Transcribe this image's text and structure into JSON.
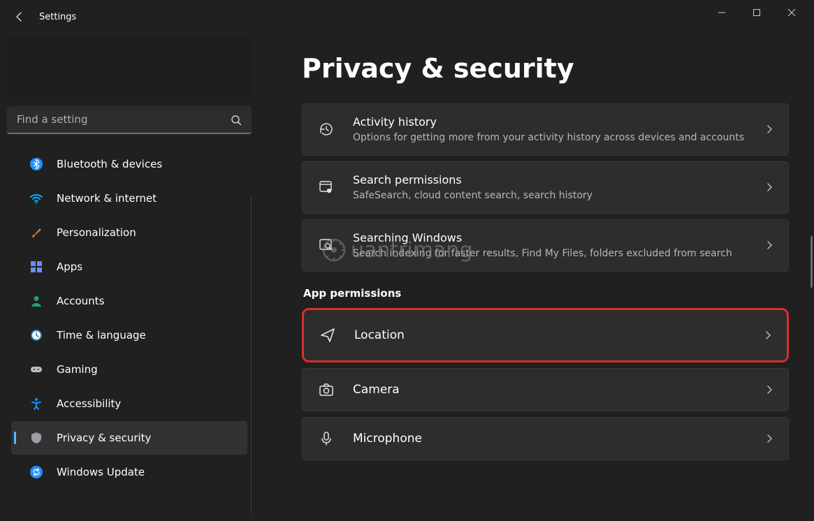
{
  "app": {
    "title": "Settings"
  },
  "search": {
    "placeholder": "Find a setting"
  },
  "sidebar": {
    "items": [
      {
        "label": "Bluetooth & devices",
        "icon": "bluetooth",
        "color": "#1e90ff"
      },
      {
        "label": "Network & internet",
        "icon": "wifi",
        "color": "#00b0ff"
      },
      {
        "label": "Personalization",
        "icon": "brush",
        "color": "#c77d3a"
      },
      {
        "label": "Apps",
        "icon": "apps",
        "color": "#6a8cff"
      },
      {
        "label": "Accounts",
        "icon": "person",
        "color": "#1fa36a"
      },
      {
        "label": "Time & language",
        "icon": "clock",
        "color": "#3aa7e0"
      },
      {
        "label": "Gaming",
        "icon": "gamepad",
        "color": "#bdbdbd"
      },
      {
        "label": "Accessibility",
        "icon": "accessibility",
        "color": "#1e90ff"
      },
      {
        "label": "Privacy & security",
        "icon": "shield",
        "color": "#9aa0a6",
        "active": true
      },
      {
        "label": "Windows Update",
        "icon": "update",
        "color": "#1e90ff"
      }
    ]
  },
  "main": {
    "title": "Privacy & security",
    "cards": [
      {
        "id": "activity-history",
        "title": "Activity history",
        "sub": "Options for getting more from your activity history across devices and accounts",
        "icon": "history"
      },
      {
        "id": "search-permissions",
        "title": "Search permissions",
        "sub": "SafeSearch, cloud content search, search history",
        "icon": "search-shield"
      },
      {
        "id": "searching-windows",
        "title": "Searching Windows",
        "sub": "Search indexing for faster results, Find My Files, folders excluded from search",
        "icon": "search"
      }
    ],
    "section_label": "App permissions",
    "perm_cards": [
      {
        "id": "location",
        "title": "Location",
        "icon": "location",
        "highlight": true
      },
      {
        "id": "camera",
        "title": "Camera",
        "icon": "camera"
      },
      {
        "id": "microphone",
        "title": "Microphone",
        "icon": "mic"
      }
    ]
  },
  "watermark": "uantrimang"
}
